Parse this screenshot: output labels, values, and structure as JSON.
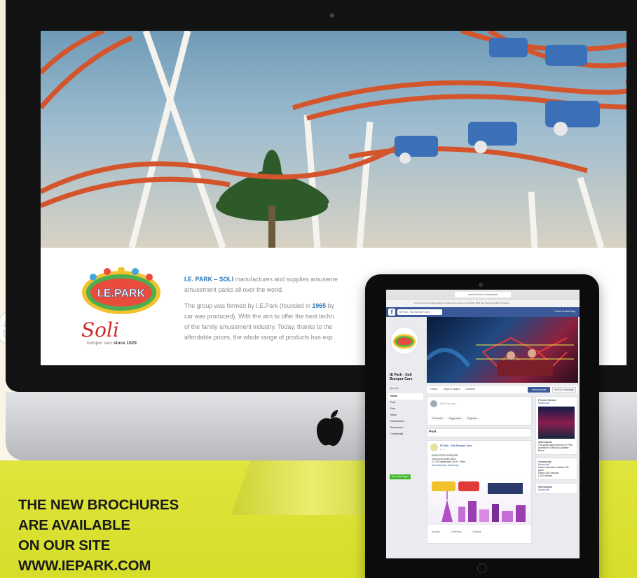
{
  "imac": {
    "about": {
      "para1_brand": "I.E. PARK – SOLI",
      "para1_text": " manufactures and supplies amuseme",
      "para1_line2": "amusement parks all over the world.",
      "para2_pre": "The group was formed by I.E.Park (founded in ",
      "para2_year": "1965",
      "para2_post": " by",
      "para2_line2": "car was produced). With the aim to offer the best techn",
      "para2_line3": "of the family amusement industry. Today, thanks to the",
      "para2_line4": "affordable prices, the whole range of products has exp"
    },
    "logo_text": "I.E.PARK",
    "soli_word": "Soli",
    "soli_sub_prefix": "bumper cars",
    "soli_sub_since": "since 1929"
  },
  "headline": {
    "line1": "THE NEW BROCHURES",
    "line2": "ARE AVAILABLE",
    "line3": "ON OUR SITE",
    "line4": "WWW.IEPARK.COM"
  },
  "tablet": {
    "url": "www.facebook.com/iepark",
    "bookmarks": "Arturo Files   Fiverr   Blogs   Brand Kit   Adsense   Art and Lore   Dribbble   BPM   Ibis   Tuesday   Outfits of Rewind",
    "search_placeholder": "IE Park - Soli Bumper Cars",
    "nav": "Home   Create   Help",
    "page_name": "IE Park - Soli Bumper Cars",
    "handle": "@iepark",
    "menu": [
      "Home",
      "Post",
      "Foto",
      "Video",
      "Informazioni",
      "Recensioni",
      "Community"
    ],
    "create_page": "Crea una Pagina",
    "actions": [
      "Ti piace",
      "Segui la pagina",
      "Condividi"
    ],
    "send_button": "Invia un'email",
    "message_button": "Invia un messaggio",
    "composer_placeholder": "Scrivi un post...",
    "composer_buttons": [
      "Foto/video",
      "Tagga amici",
      "Registrati"
    ],
    "posts_label": "Post",
    "post": {
      "author": "IE Park - Soli Bumper Cars",
      "time": "11 h",
      "line1": "EURO EXPO EUROPE",
      "line2": "Visit us at booth 8201",
      "line3": "17-19 September 2019 - Paris",
      "link": "#soli #ieparks #eaaexpo"
    },
    "reactions": [
      "Mi piace",
      "Commenta",
      "Condividi"
    ],
    "right_card_title": "Persone dicono",
    "right_card_link": "Mostra tutti",
    "right_about": "Informazioni",
    "right_about_text": "This group was formed by I.E.Park (founded in 1965) by Cavaliere Bruno",
    "community_title": "Community",
    "community_link": "Mostra tutti",
    "community_items": [
      "Invita i tuoi amici a mettere \"Mi piace\"",
      "Piace a 562 persone",
      "1.102 follower"
    ],
    "info_title": "Informazioni",
    "info_link": "Mostra tutti"
  }
}
